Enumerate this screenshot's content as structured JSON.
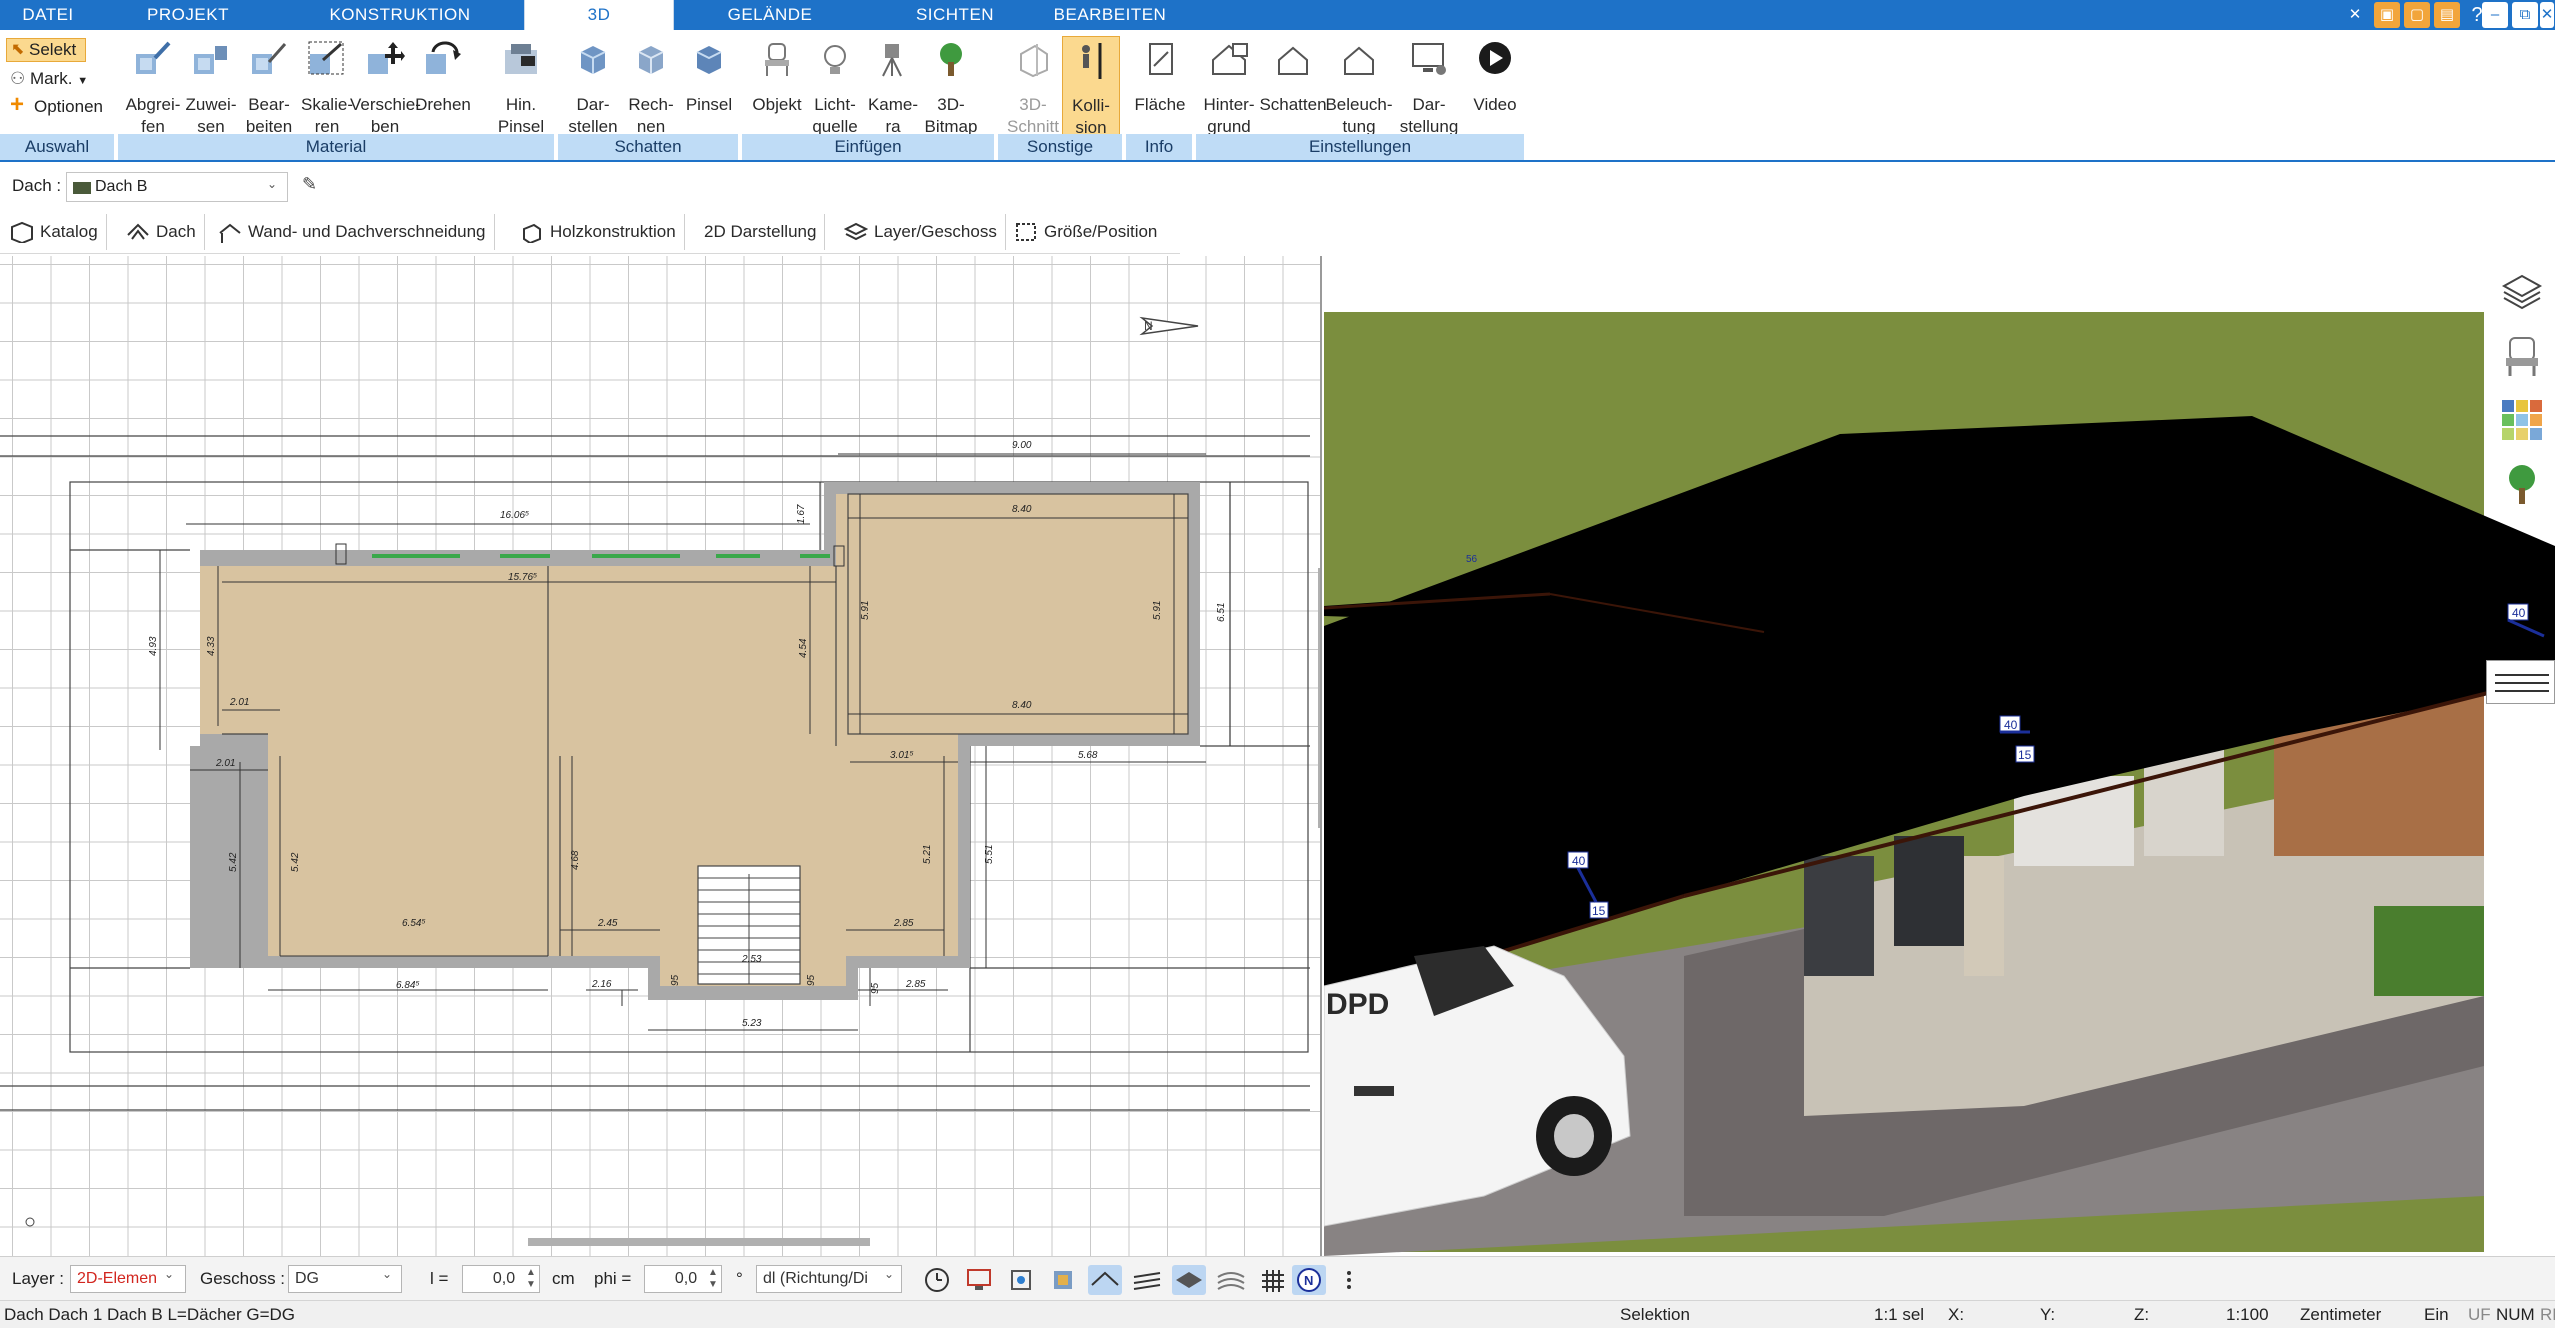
{
  "menu": {
    "tabs": [
      "DATEI",
      "PROJEKT",
      "KONSTRUKTION",
      "3D",
      "GELÄNDE",
      "SICHTEN",
      "BEARBEITEN"
    ],
    "active": "3D"
  },
  "window_controls": [
    "tools-icon",
    "save-icon",
    "window-icon",
    "window-icon",
    "help-icon",
    "minimize-icon",
    "restore-icon",
    "close-icon"
  ],
  "ribbon": {
    "auswahl": {
      "caption": "Auswahl",
      "selekt": "Selekt",
      "mark": "Mark.",
      "optionen": "Optionen"
    },
    "material": {
      "caption": "Material",
      "buttons": [
        "Abgrei-\nfen",
        "Zuwei-\nsen",
        "Bear-\nbeiten",
        "Skalie-\nren",
        "Verschie-\nben",
        "Drehen",
        "Hin.\nPinsel"
      ]
    },
    "schatten": {
      "caption": "Schatten",
      "buttons": [
        "Dar-\nstellen",
        "Rech-\nnen",
        "Pinsel"
      ]
    },
    "einfuegen": {
      "caption": "Einfügen",
      "buttons": [
        "Objekt",
        "Licht-\nquelle",
        "Kame-\nra",
        "3D-\nBitmap"
      ]
    },
    "sonstige": {
      "caption": "Sonstige",
      "buttons": [
        "3D-\nSchnitt",
        "Kolli-\nsion"
      ]
    },
    "info": {
      "caption": "Info",
      "buttons": [
        "Fläche"
      ]
    },
    "einstellungen": {
      "caption": "Einstellungen",
      "buttons": [
        "Hinter-\ngrund",
        "Schatten",
        "Beleuch-\ntung",
        "Dar-\nstellung",
        "Video"
      ]
    }
  },
  "roofbar": {
    "label": "Dach :",
    "value": "Dach B"
  },
  "toolbar2": [
    "Katalog",
    "Dach",
    "Wand- und Dachverschneidung",
    "Holzkonstruktion",
    "2D Darstellung",
    "Layer/Geschoss",
    "Größe/Position"
  ],
  "plan": {
    "dims": {
      "d900": "9.00",
      "d1606": "16.06⁵",
      "d1576": "15.76⁵",
      "d840a": "8.40",
      "d840b": "8.40",
      "d167": "1.67",
      "d493": "4.93",
      "d433": "4.33",
      "d454": "4.54",
      "d591a": "5.91",
      "d591b": "5.91",
      "d651": "6.51",
      "d201a": "2.01",
      "d201b": "2.01",
      "d301": "3.01⁵",
      "d568": "5.68",
      "d542a": "5.42",
      "d542b": "5.42",
      "d468": "4.68",
      "d521": "5.21",
      "d551": "5.51",
      "d654": "6.54⁵",
      "d245": "2.45",
      "d285a": "2.85",
      "d253": "2.53",
      "d684": "6.84⁵",
      "d216": "2.16",
      "d95a": "95",
      "d95b": "95",
      "d95c": "95",
      "d285b": "2.85",
      "d523": "5.23"
    }
  },
  "view3d": {
    "tags": [
      "40",
      "40",
      "40",
      "15",
      "15",
      "56"
    ],
    "van_text": "DPD"
  },
  "options": {
    "layer_label": "Layer :",
    "layer_value": "2D-Elemen",
    "geschoss_label": "Geschoss :",
    "geschoss_value": "DG",
    "l_label": "l =",
    "l_value": "0,0",
    "l_unit": "cm",
    "phi_label": "phi =",
    "phi_value": "0,0",
    "phi_unit": "°",
    "dir_value": "dl (Richtung/Di"
  },
  "status": {
    "left": "Dach Dach 1 Dach B L=Dächer G=DG",
    "mode": "Selektion",
    "sel": "1:1 sel",
    "x": "X:",
    "y": "Y:",
    "z": "Z:",
    "scale": "1:100",
    "unit": "Zentimeter",
    "ein": "Ein",
    "uf": "UF",
    "num": "NUM",
    "rf": "RF"
  },
  "colors": {
    "accent": "#1e72c8",
    "ribbon_caption": "#bfdcf6",
    "active_button": "#fbd98f",
    "floor": "#d8c3a0",
    "wall": "#a8a8a8",
    "roof": "#000000",
    "grass": "#7a8f3e"
  }
}
